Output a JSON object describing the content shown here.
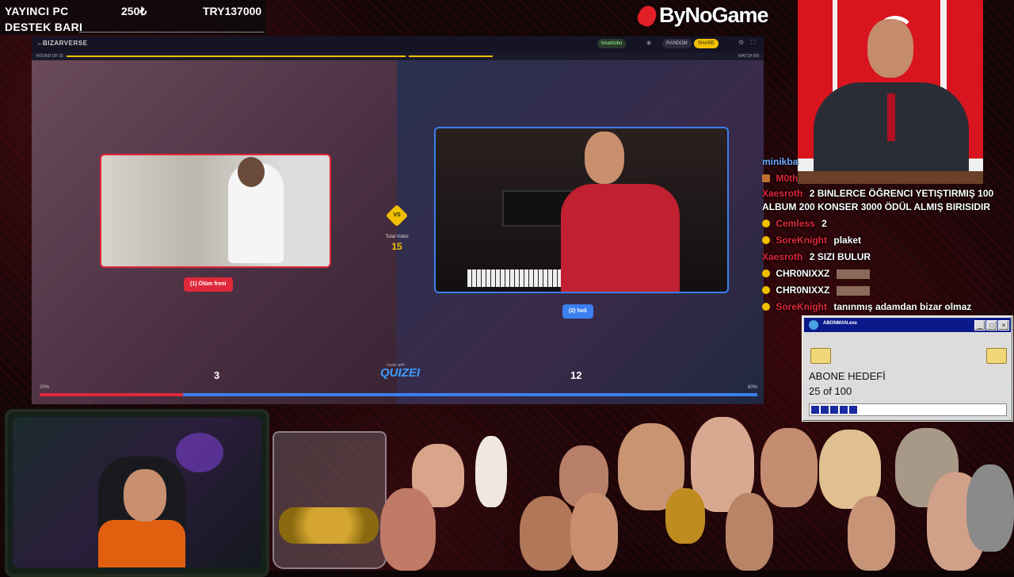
{
  "overlay": {
    "row1_label": "YAYINCI PC",
    "row1_amount": "250₺",
    "row1_goal": "TRY137000",
    "row2_label": "DESTEK BARI",
    "brand": "ByNoGame"
  },
  "game": {
    "title": "BIZARVERSE",
    "user_pill": "bisarbobo",
    "mode_pill": "RANDOM",
    "action_pill": "SHARE",
    "round_label": "ROUND OF 16",
    "match_label": "MATCH 8/8",
    "left_tag": "(1) Ölüm freni",
    "right_tag": "(2) hoš",
    "vs": "VS",
    "total_votes_label": "Total Votes",
    "total_votes": "15",
    "left_count": "3",
    "right_count": "12",
    "made_with": "made with",
    "logo": "QUIZEI",
    "left_pct": "20%",
    "right_pct": "80%",
    "left_share": 0.2
  },
  "chat": {
    "messages": [
      {
        "user": "minikba",
        "text": ""
      },
      {
        "user": "M0th",
        "text": ""
      },
      {
        "user": "Xaesroth",
        "text": "2 BINLERCE ÖĞRENCI YETIŞTIRMIŞ 100 ALBUM 200 KONSER 3000 ÖDÜL ALMIŞ BIRISIDIR"
      },
      {
        "user": "Cemless",
        "text": "2"
      },
      {
        "user": "SoreKnight",
        "text": "plaket"
      },
      {
        "user": "Xaesroth",
        "text": "2 SIZI BULUR"
      },
      {
        "user": "CHR0NIXXZ",
        "text": ""
      },
      {
        "user": "CHR0NIXXZ",
        "text": ""
      },
      {
        "user": "SoreKnight",
        "text": "tanınmış adamdan bizar olmaz"
      }
    ]
  },
  "subgoal": {
    "window_title": "ABONMAN.exe",
    "title": "ABONE HEDEFİ",
    "progress_text": "25 of 100",
    "progress": 0.25
  }
}
